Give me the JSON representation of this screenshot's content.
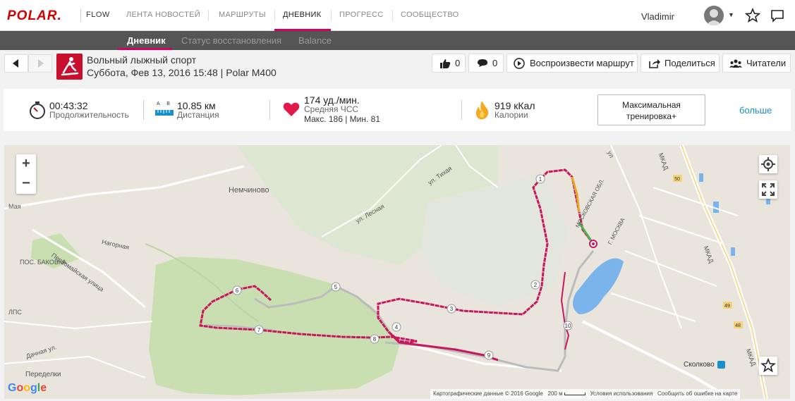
{
  "brand": {
    "logo": "POLAR.",
    "product": "FLOW"
  },
  "topnav": {
    "items": [
      "ЛЕНТА НОВОСТЕЙ",
      "МАРШРУТЫ",
      "ДНЕВНИК",
      "ПРОГРЕСС",
      "СООБЩЕСТВО"
    ],
    "active": "ДНЕВНИК",
    "username": "Vladimir"
  },
  "subnav": {
    "items": [
      "Дневник",
      "Статус восстановления",
      "Balance"
    ],
    "active": "Дневник"
  },
  "session": {
    "title": "Вольный лыжный спорт",
    "subtitle": "Суббота, Фев 13, 2016 15:48 | Polar M400",
    "likes": "0",
    "comments": "0",
    "play_route": "Воспроизвести маршрут",
    "share": "Поделиться",
    "followers": "Читатели"
  },
  "summary": {
    "duration": {
      "value": "00:43:32",
      "label": "Продолжительность"
    },
    "distance": {
      "value": "10.85 км",
      "label": "Дистанция",
      "icon_letters": "A B"
    },
    "heart_rate": {
      "value": "174 уд./мин.",
      "label": "Средняя ЧСС",
      "detail": "Макс. 186 | Мин. 81"
    },
    "calories": {
      "value": "919 кКал",
      "label": "Калории"
    },
    "max_training_line1": "Максимальная",
    "max_training_line2": "тренировка+",
    "more": "больше"
  },
  "map": {
    "labels": {
      "nemchinovo": "Немчиново",
      "nagornaya": "Нагорная",
      "pervomayskaya": "Первомайская улица",
      "bakovka": "ПОС. БАКОВКА",
      "maya": "Мая",
      "lesnaya": "ул. Лесная",
      "tikhaya": "ул. Тихая",
      "dachnaya": "Дачная ул.",
      "peredelki": "Переделки",
      "mosobl": "МОСКОВСКАЯ ОБЛ.",
      "moskva": "Г. МОСКВА",
      "mkad1": "МКАД",
      "mkad2": "МКАД",
      "mkad3": "МКАД",
      "skolkovo": "Сколково",
      "r50": "50",
      "r49": "49",
      "r48": "48",
      "lps": "ЛПС",
      "ul": "ул"
    },
    "markers": [
      "1",
      "2",
      "3",
      "4",
      "5",
      "6",
      "7",
      "8",
      "9",
      "10"
    ],
    "attribution": {
      "data": "Картографические данные © 2016 Google",
      "scale": "200 м",
      "terms": "Условия использования",
      "report": "Сообщить об ошибке на карте"
    },
    "google": [
      "G",
      "o",
      "o",
      "g",
      "l",
      "e"
    ],
    "zoom_in": "+",
    "zoom_out": "−",
    "colors": {
      "route": "#c8175d",
      "route_gray": "#bbbbbb",
      "park": "#c8dfb0",
      "water": "#7ab4ea",
      "road": "#ffffff"
    }
  }
}
